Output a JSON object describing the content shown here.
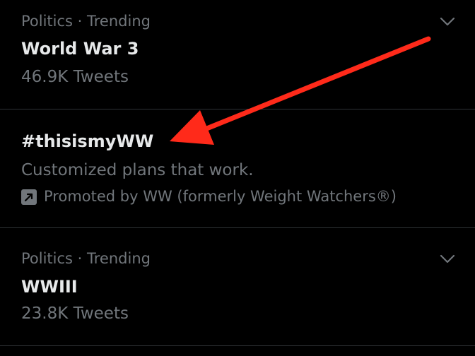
{
  "trends": [
    {
      "meta": "Politics · Trending",
      "title": "World War 3",
      "count": "46.9K Tweets"
    },
    {
      "title": "#thisismyWW",
      "description": "Customized plans that work.",
      "promoted": "Promoted by WW (formerly Weight Watchers®)"
    },
    {
      "meta": "Politics · Trending",
      "title": "WWIII",
      "count": "23.8K Tweets"
    }
  ],
  "icons": {
    "more": "chevron-down-icon",
    "promoted": "promoted-arrow-icon"
  },
  "colors": {
    "background": "#000000",
    "primary_text": "#e7e9ea",
    "secondary_text": "#71767b",
    "divider": "#2f3336",
    "annotation_arrow": "#ff2a1a"
  }
}
